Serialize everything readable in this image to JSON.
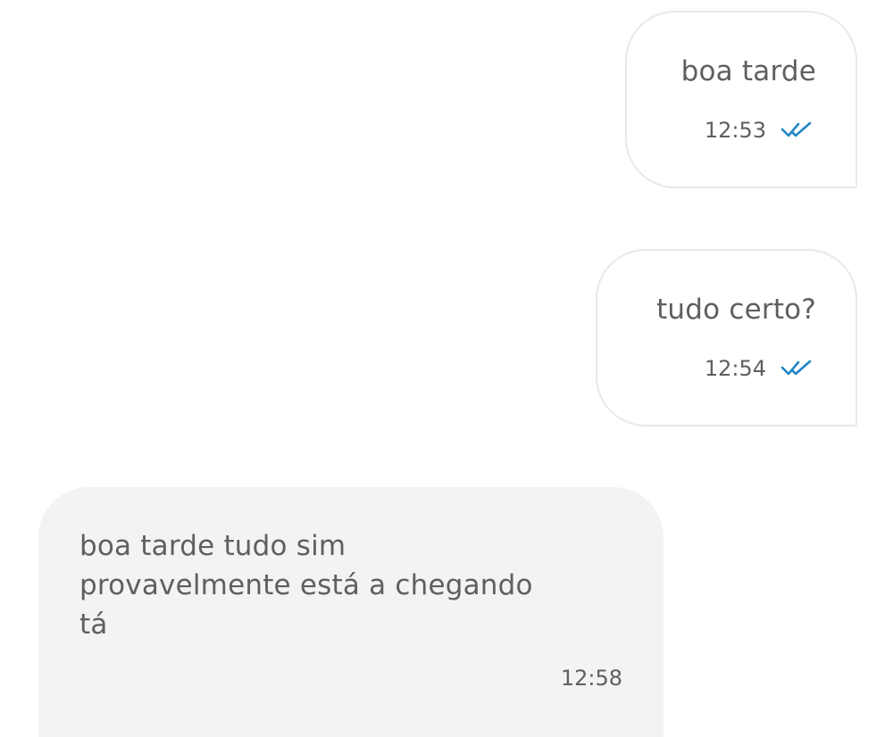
{
  "messages": [
    {
      "direction": "outgoing",
      "text_lines": [
        "boa tarde"
      ],
      "time": "12:53",
      "status": "read",
      "status_icon": "double-check-icon"
    },
    {
      "direction": "outgoing",
      "text_lines": [
        "tudo certo?"
      ],
      "time": "12:54",
      "status": "read",
      "status_icon": "double-check-icon"
    },
    {
      "direction": "incoming",
      "text_lines": [
        "boa tarde tudo sim",
        "provavelmente está a chegando",
        "tá"
      ],
      "time": "12:58"
    }
  ],
  "colors": {
    "text": "#5f5f5f",
    "outgoing_bubble_bg": "#ffffff",
    "outgoing_bubble_border": "#e9e9e9",
    "incoming_bubble_bg": "#f3f3f3",
    "read_check": "#1f86c4"
  }
}
